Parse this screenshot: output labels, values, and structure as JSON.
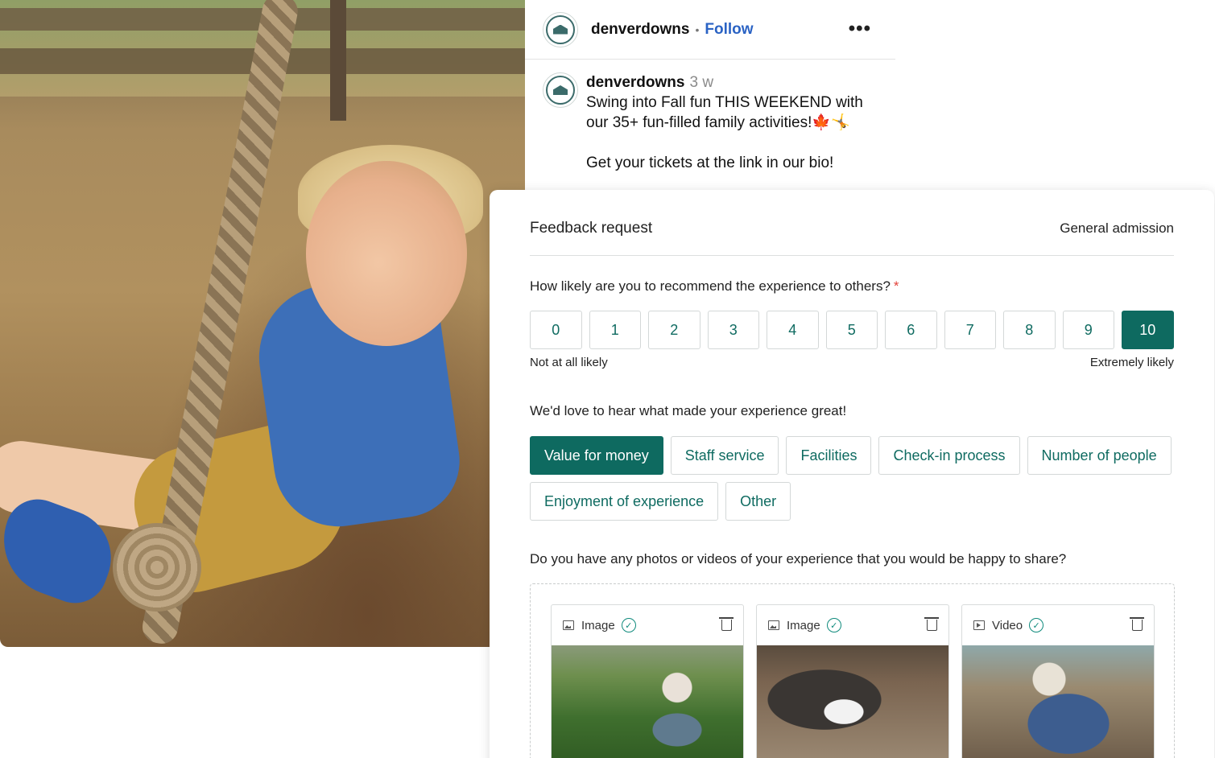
{
  "post": {
    "username": "denverdowns",
    "follow_label": "Follow",
    "more_label": "•••",
    "caption": {
      "username": "denverdowns",
      "time": "3 w",
      "line1": "Swing into Fall fun THIS WEEKEND with",
      "line2": "our 35+ fun-filled family activities!🍁🤸",
      "line3": "Get your tickets at the link in our bio!"
    }
  },
  "feedback": {
    "title": "Feedback request",
    "subtitle": "General admission",
    "q1": "How likely are you to recommend the experience to others?",
    "q1_required_mark": "*",
    "scale": [
      "0",
      "1",
      "2",
      "3",
      "4",
      "5",
      "6",
      "7",
      "8",
      "9",
      "10"
    ],
    "scale_selected": "10",
    "scale_low_label": "Not at all likely",
    "scale_high_label": "Extremely likely",
    "q2": "We'd love to hear what made your experience great!",
    "chips": [
      "Value for money",
      "Staff service",
      "Facilities",
      "Check-in process",
      "Number of people",
      "Enjoyment of experience",
      "Other"
    ],
    "chips_selected": [
      "Value for money"
    ],
    "q3": "Do you have any photos or videos of your experience that you would be happy to share?",
    "media": [
      {
        "type": "Image",
        "icon": "image-icon"
      },
      {
        "type": "Image",
        "icon": "image-icon"
      },
      {
        "type": "Video",
        "icon": "video-icon"
      }
    ]
  },
  "colors": {
    "accent": "#0e6a60",
    "follow": "#2b63c4",
    "required": "#e2433b"
  }
}
